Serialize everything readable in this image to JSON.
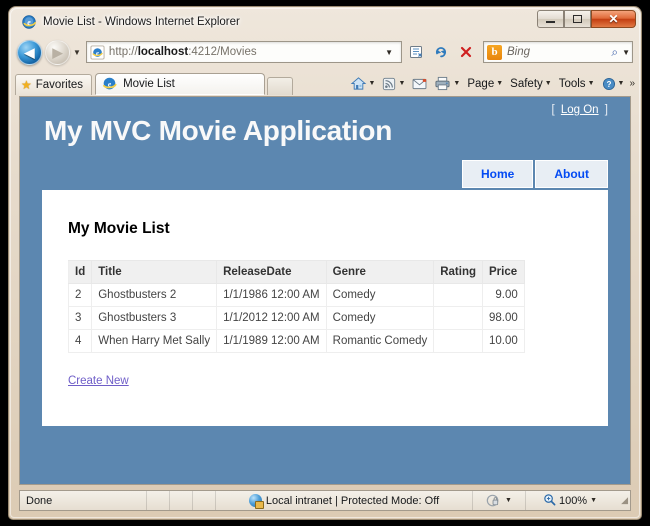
{
  "window": {
    "title": "Movie List - Windows Internet Explorer",
    "icon": "ie-logo-icon",
    "controls": {
      "minimize": "Minimize",
      "maximize": "Maximize",
      "close": "Close",
      "close_glyph": "✕"
    }
  },
  "navigation": {
    "back": "◀",
    "forward": "▶",
    "history_caret": "▼",
    "address": {
      "url_prefix": "http://",
      "url_host": "localhost",
      "url_suffix": ":4212/Movies",
      "full_url": "http://localhost:4212/Movies",
      "dropdown_caret": "▼",
      "compat_button": "Compatibility View",
      "refresh_button": "↻",
      "refresh_glyph": "↻",
      "stop_button": "✕"
    },
    "search": {
      "provider": "Bing",
      "provider_initial": "b",
      "placeholder": "Bing",
      "magnifier": "⌕",
      "caret": "▼"
    }
  },
  "tabbar": {
    "favorites_label": "Favorites",
    "favorites_icon": "star-icon",
    "tabs": [
      {
        "label": "Movie List",
        "icon": "ie-logo-icon",
        "active": true
      }
    ],
    "new_tab_label": ""
  },
  "commandbar": {
    "items": [
      {
        "name": "home",
        "label": "",
        "icon": "home-icon",
        "caret": "▼"
      },
      {
        "name": "feeds",
        "label": "",
        "icon": "rss-icon",
        "caret": "▼"
      },
      {
        "name": "read-mail",
        "label": "",
        "icon": "mail-icon",
        "caret": ""
      },
      {
        "name": "print",
        "label": "",
        "icon": "printer-icon",
        "caret": "▼"
      },
      {
        "name": "page",
        "label": "Page",
        "icon": "",
        "caret": "▼"
      },
      {
        "name": "safety",
        "label": "Safety",
        "icon": "",
        "caret": "▼"
      },
      {
        "name": "tools",
        "label": "Tools",
        "icon": "",
        "caret": "▼"
      },
      {
        "name": "help",
        "label": "",
        "icon": "help-icon",
        "caret": "▼"
      }
    ],
    "overflow": "»"
  },
  "page": {
    "site_title": "My MVC Movie Application",
    "logon": {
      "bracket_open": "[",
      "link": "Log On",
      "bracket_close": "]"
    },
    "menu": [
      {
        "label": "Home"
      },
      {
        "label": "About"
      }
    ],
    "content_heading": "My Movie List",
    "table": {
      "columns": [
        "Id",
        "Title",
        "ReleaseDate",
        "Genre",
        "Rating",
        "Price"
      ],
      "rows": [
        {
          "id": "2",
          "title": "Ghostbusters 2",
          "release_date": "1/1/1986 12:00 AM",
          "genre": "Comedy",
          "rating": "",
          "price": "9.00"
        },
        {
          "id": "3",
          "title": "Ghostbusters 3",
          "release_date": "1/1/2012 12:00 AM",
          "genre": "Comedy",
          "rating": "",
          "price": "98.00"
        },
        {
          "id": "4",
          "title": "When Harry Met Sally",
          "release_date": "1/1/1989 12:00 AM",
          "genre": "Romantic Comedy",
          "rating": "",
          "price": "10.00"
        }
      ]
    },
    "create_new_link": "Create New"
  },
  "statusbar": {
    "status": "Done",
    "zone": "Local intranet | Protected Mode: Off",
    "zone_icon": "internet-zone-icon",
    "privacy_icon": "privacy-report-icon",
    "privacy_caret": "▼",
    "zoom_icon": "zoom-icon",
    "zoom_level": "100%",
    "zoom_caret": "▼",
    "resize_grip": "◢"
  },
  "colors": {
    "header_blue": "#5c87b0",
    "menu_text_blue": "#034af3",
    "menu_bg": "#e8eef4",
    "link_purple": "#6f5ec8",
    "table_header_bg": "#f0f0f0",
    "close_button_red": "#c33f12"
  }
}
